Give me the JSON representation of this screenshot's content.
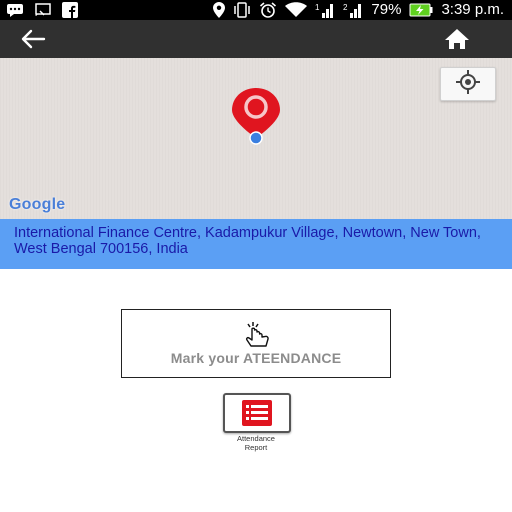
{
  "status_bar": {
    "battery_percent": "79%",
    "time": "3:39 p.m.",
    "icons": [
      "message-icon",
      "cast-icon",
      "facebook-icon",
      "location-icon",
      "vibrate-icon",
      "alarm-icon",
      "wifi-icon",
      "sim1-signal-icon",
      "sim2-signal-icon",
      "battery-charging-icon"
    ]
  },
  "toolbar": {
    "back_icon": "back-arrow-icon",
    "home_icon": "home-icon"
  },
  "map": {
    "provider": "Google",
    "locate_icon": "my-location-icon",
    "pin_color": "#e0151f",
    "dot_color": "#3b7fe0"
  },
  "address": {
    "text": "International Finance Centre, Kadampukur Village, Newtown, New Town, West Bengal 700156, India"
  },
  "attendance": {
    "button_label": "Mark your ATEENDANCE",
    "icon": "tap-hand-icon"
  },
  "report": {
    "icon": "attendance-report-icon",
    "label_line1": "Attendance",
    "label_line2": "Report"
  }
}
